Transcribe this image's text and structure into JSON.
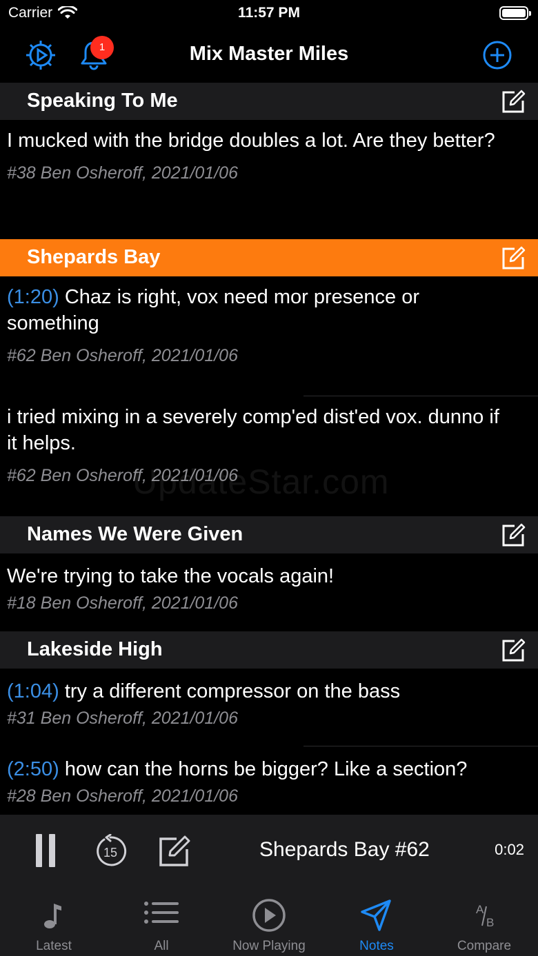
{
  "status_bar": {
    "carrier": "Carrier",
    "time": "11:57 PM"
  },
  "nav": {
    "title": "Mix Master Miles",
    "badge_count": "1"
  },
  "songs": [
    {
      "title": "Speaking To Me",
      "active": false,
      "notes": [
        {
          "timestamp": "",
          "text": "I mucked with the bridge doubles a lot.  Are they better?",
          "meta": "#38 Ben Osheroff, 2021/01/06"
        }
      ]
    },
    {
      "title": "Shepards Bay",
      "active": true,
      "notes": [
        {
          "timestamp": "(1:20)",
          "text": "Chaz is right, vox need mor presence or something",
          "meta": "#62 Ben Osheroff, 2021/01/06"
        },
        {
          "timestamp": "",
          "text": "i tried mixing in a severely comp'ed dist'ed vox. dunno if it helps.",
          "meta": "#62 Ben Osheroff, 2021/01/06"
        }
      ]
    },
    {
      "title": "Names We Were Given",
      "active": false,
      "notes": [
        {
          "timestamp": "",
          "text": "We're trying to take the vocals again!",
          "meta": "#18 Ben Osheroff, 2021/01/06"
        }
      ]
    },
    {
      "title": "Lakeside High",
      "active": false,
      "notes": [
        {
          "timestamp": "(1:04)",
          "text": "try a different compressor on the bass",
          "meta": "#31 Ben Osheroff, 2021/01/06"
        },
        {
          "timestamp": "(2:50)",
          "text": "how can the horns be bigger?  Like a section?",
          "meta": "#28 Ben Osheroff, 2021/01/06"
        }
      ]
    }
  ],
  "watermark": "UpdateStar.com",
  "player": {
    "title": "Shepards Bay #62",
    "time": "0:02",
    "rewind_seconds": "15"
  },
  "tabs": [
    {
      "label": "Latest",
      "icon": "music-note-icon",
      "selected": false
    },
    {
      "label": "All",
      "icon": "list-icon",
      "selected": false
    },
    {
      "label": "Now Playing",
      "icon": "play-circle-icon",
      "selected": false
    },
    {
      "label": "Notes",
      "icon": "paper-plane-icon",
      "selected": true
    },
    {
      "label": "Compare",
      "icon": "a-b-icon",
      "selected": false
    }
  ],
  "colors": {
    "accent": "#1e8af5",
    "active_song": "#fd7b0f",
    "timestamp": "#3b8fe5",
    "badge": "#ff2d1f",
    "meta": "#8e8e93"
  }
}
